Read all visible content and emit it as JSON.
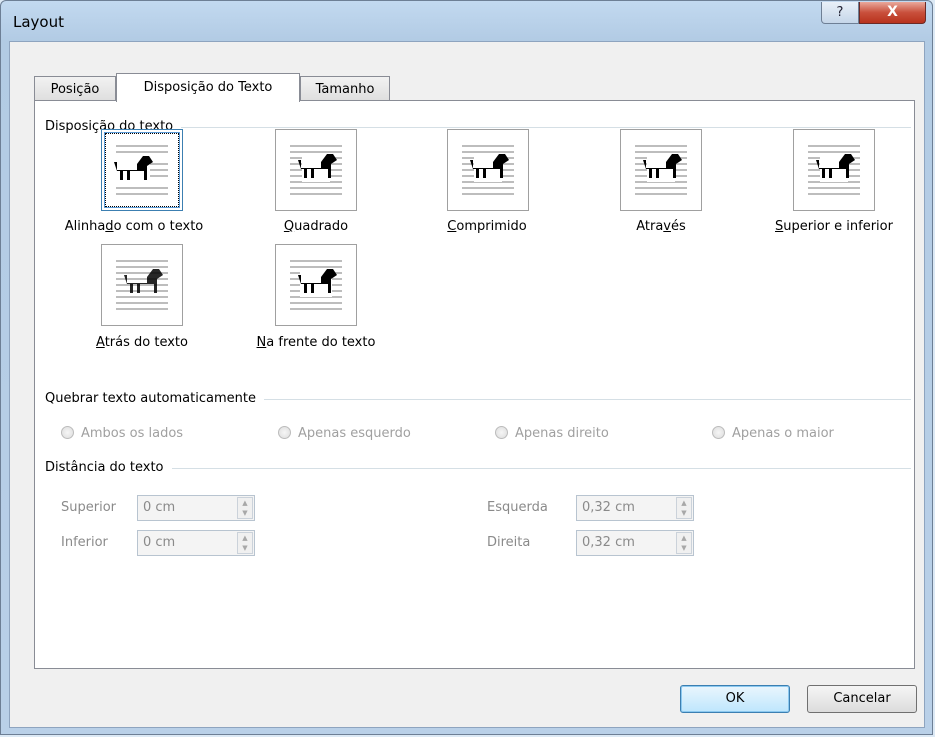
{
  "window": {
    "title": "Layout",
    "help_label": "?",
    "close_label": "X"
  },
  "tabs": [
    {
      "label": "Posição",
      "active": false
    },
    {
      "label": "Disposição do Texto",
      "active": true
    },
    {
      "label": "Tamanho",
      "active": false
    }
  ],
  "wrapping": {
    "heading": "Disposição do texto",
    "options": [
      {
        "pre": "Alinha",
        "key": "d",
        "post": "o com o texto",
        "icon": "inline-with-text-icon",
        "selected": true
      },
      {
        "pre": "",
        "key": "Q",
        "post": "uadrado",
        "icon": "square-wrap-icon",
        "selected": false
      },
      {
        "pre": "",
        "key": "C",
        "post": "omprimido",
        "icon": "tight-wrap-icon",
        "selected": false
      },
      {
        "pre": "Atra",
        "key": "v",
        "post": "és",
        "icon": "through-wrap-icon",
        "selected": false
      },
      {
        "pre": "",
        "key": "S",
        "post": "uperior e inferior",
        "icon": "top-bottom-wrap-icon",
        "selected": false
      },
      {
        "pre": "",
        "key": "A",
        "post": "trás do texto",
        "icon": "behind-text-icon",
        "selected": false
      },
      {
        "pre": "",
        "key": "N",
        "post": "a frente do texto",
        "icon": "in-front-text-icon",
        "selected": false
      }
    ]
  },
  "auto_break": {
    "heading": "Quebrar texto automaticamente",
    "radios": [
      "Ambos os lados",
      "Apenas esquerdo",
      "Apenas direito",
      "Apenas o maior"
    ]
  },
  "distance": {
    "heading": "Distância do texto",
    "top_label": "Superior",
    "top_value": "0 cm",
    "bottom_label": "Inferior",
    "bottom_value": "0 cm",
    "left_label": "Esquerda",
    "left_value": "0,32 cm",
    "right_label": "Direita",
    "right_value": "0,32 cm"
  },
  "buttons": {
    "ok": "OK",
    "cancel": "Cancelar"
  }
}
